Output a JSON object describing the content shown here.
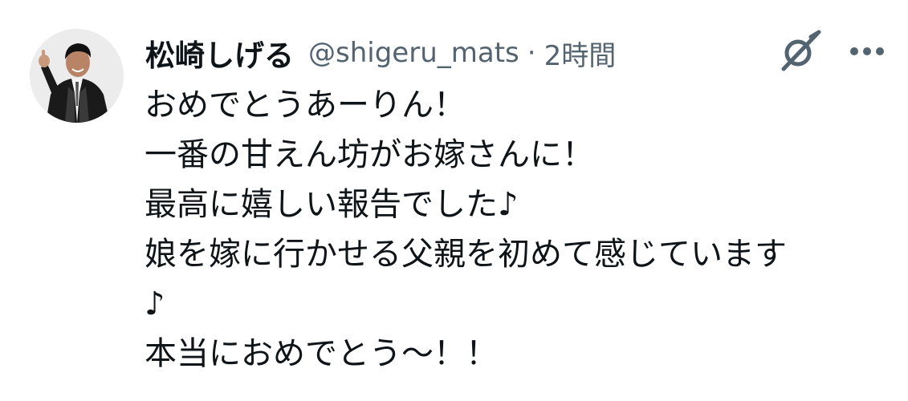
{
  "tweet": {
    "author": {
      "display_name": "松崎しげる",
      "handle": "@shigeru_mats",
      "separator": "·",
      "timestamp": "2時間"
    },
    "actions": {
      "grok_icon": "grok-icon",
      "more_icon": "more-horizontal-icon"
    },
    "lines": [
      "おめでとうあーりん！",
      "一番の甘えん坊がお嫁さんに！",
      "最高に嬉しい報告でした♪",
      "娘を嫁に行かせる父親を初めて感じています",
      "♪",
      "本当におめでとう〜！！"
    ]
  },
  "colors": {
    "text_primary": "#0f1419",
    "text_secondary": "#536471",
    "background": "#ffffff"
  }
}
